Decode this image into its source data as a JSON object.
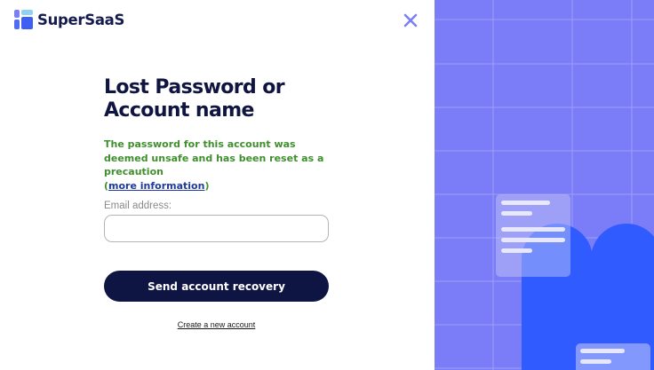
{
  "brand": {
    "name": "SuperSaaS"
  },
  "page": {
    "title_line1": "Lost Password or",
    "title_line2": "Account name"
  },
  "notice": {
    "text": "The password for this account was deemed unsafe and has been reset as a precaution",
    "open_paren": "(",
    "link_text": "more information",
    "close_paren": ")"
  },
  "form": {
    "email_label": "Email address:",
    "email_value": "",
    "submit_label": "Send account recovery"
  },
  "footer": {
    "create_account_link": "Create a new account"
  },
  "icons": {
    "close": "close-icon",
    "logo": "supersaas-logo-icon"
  },
  "colors": {
    "primary_dark": "#0f1542",
    "notice_green": "#3f8f2f",
    "link_blue": "#1f3a9e",
    "panel_purple": "#7a7df7",
    "shape_blue": "#2f5bff"
  }
}
